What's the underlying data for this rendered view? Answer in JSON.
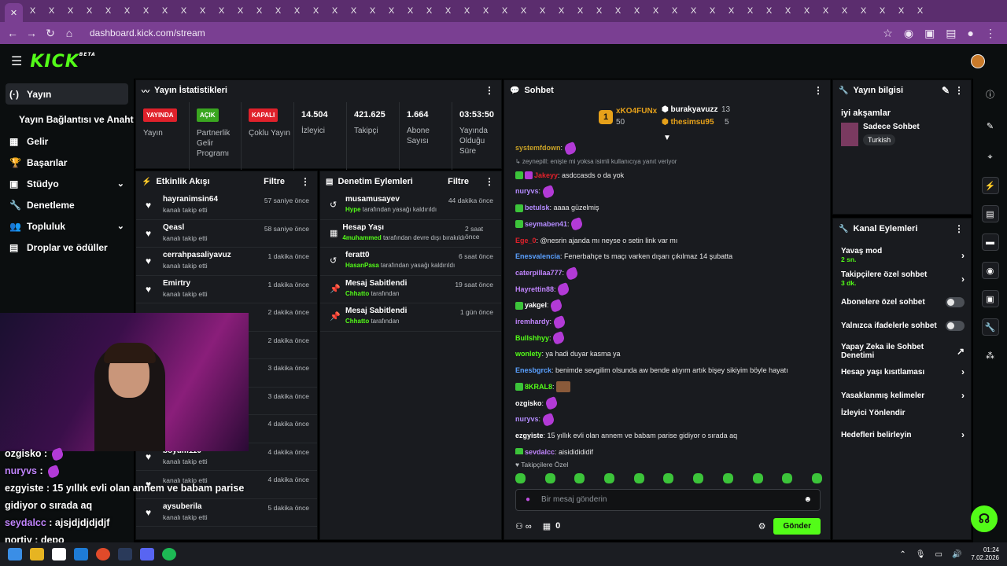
{
  "browser": {
    "url": "dashboard.kick.com/stream",
    "tab_icons": [
      "X",
      "X",
      "X",
      "X",
      "X",
      "X",
      "X",
      "X",
      "X",
      "X",
      "X",
      "X",
      "X",
      "X",
      "X",
      "X",
      "X",
      "X",
      "X",
      "X",
      "X",
      "X",
      "X",
      "X",
      "X",
      "X",
      "X",
      "X",
      "X",
      "X",
      "X",
      "X",
      "X",
      "X",
      "X",
      "X",
      "X",
      "X",
      "X",
      "X",
      "X",
      "X",
      "X",
      "X",
      "X",
      "X",
      "X",
      "X"
    ]
  },
  "header": {
    "logo": "KICK",
    "logo_sup": "BETA"
  },
  "sidebar": {
    "items": [
      {
        "label": "Yayın",
        "icon": "stream-icon",
        "glyph": "(·)",
        "selected": true
      },
      {
        "label": "Gelir",
        "icon": "revenue-icon",
        "glyph": "▦"
      },
      {
        "label": "Başarılar",
        "icon": "trophy-icon",
        "glyph": "🏆"
      },
      {
        "label": "Stüdyo",
        "icon": "studio-icon",
        "glyph": "▣",
        "chevron": true
      },
      {
        "label": "Denetleme",
        "icon": "wrench-icon",
        "glyph": "🔧"
      },
      {
        "label": "Topluluk",
        "icon": "community-icon",
        "glyph": "👥",
        "chevron": true
      },
      {
        "label": "Droplar ve ödüller",
        "icon": "gift-icon",
        "glyph": "▤"
      }
    ],
    "subitem": "Yayın Bağlantısı ve Anahtarı"
  },
  "stats": {
    "title": "Yayın İstatistikleri",
    "cards": [
      {
        "badge": "YAYINDA",
        "badge_color": "#e0212b",
        "label": "Yayın"
      },
      {
        "badge": "AÇIK",
        "badge_color": "#3aa620",
        "label": "Partnerlik Gelir Programı"
      },
      {
        "badge": "KAPALI",
        "badge_color": "#e0212b",
        "label": "Çoklu Yayın"
      },
      {
        "value": "14.504",
        "label": "İzleyici"
      },
      {
        "value": "421.625",
        "label": "Takipçi"
      },
      {
        "value": "1.664",
        "label": "Abone Sayısı"
      },
      {
        "value": "03:53:50",
        "label": "Yayında Olduğu Süre"
      }
    ]
  },
  "activity": {
    "title": "Etkinlik Akışı",
    "filter": "Filtre",
    "rows": [
      {
        "name": "hayranimsin64",
        "sub": "kanalı takip etti",
        "time": "57 saniye önce"
      },
      {
        "name": "Qeasl",
        "sub": "kanalı takip etti",
        "time": "58 saniye önce"
      },
      {
        "name": "cerrahpasaliyavuz",
        "sub": "kanalı takip etti",
        "time": "1 dakika önce"
      },
      {
        "name": "Emirtry",
        "sub": "kanalı takip etti",
        "time": "1 dakika önce"
      },
      {
        "name": "",
        "sub": "",
        "time": "2 dakika önce"
      },
      {
        "name": "",
        "sub": "",
        "time": "2 dakika önce"
      },
      {
        "name": "",
        "sub": "",
        "time": "3 dakika önce"
      },
      {
        "name": "",
        "sub": "",
        "time": "3 dakika önce"
      },
      {
        "name": "",
        "sub": "",
        "time": "4 dakika önce"
      },
      {
        "name": "boyum110",
        "sub": "kanalı takip etti",
        "time": "4 dakika önce"
      },
      {
        "name": "",
        "sub": "kanalı takip etti",
        "time": "4 dakika önce"
      },
      {
        "name": "aysuberila",
        "sub": "kanalı takip etti",
        "time": "5 dakika önce"
      }
    ]
  },
  "moderation": {
    "title": "Denetim Eylemleri",
    "filter": "Filtre",
    "rows": [
      {
        "icon": "undo-icon",
        "glyph": "↺",
        "name": "musamusayev",
        "actor": "Hype",
        "sub": " tarafından yasağı kaldırıldı",
        "time": "44 dakika önce"
      },
      {
        "icon": "calendar-icon",
        "glyph": "▦",
        "name": "Hesap Yaşı",
        "actor": "4muhammed",
        "sub": " tarafından devre dışı bırakıldı",
        "time": "2 saat önce"
      },
      {
        "icon": "undo-icon",
        "glyph": "↺",
        "name": "feratt0",
        "actor": "HasanPasa",
        "sub": " tarafından yasağı kaldırıldı",
        "time": "6 saat önce"
      },
      {
        "icon": "pin-icon",
        "glyph": "📌",
        "name": "Mesaj Sabitlendi",
        "actor": "Chhatto",
        "sub": " tarafından",
        "time": "19 saat önce"
      },
      {
        "icon": "pin-icon",
        "glyph": "📌",
        "name": "Mesaj Sabitlendi",
        "actor": "Chhatto",
        "sub": " tarafından",
        "time": "1 gün önce"
      }
    ]
  },
  "chat": {
    "title": "Sohbet",
    "leader": {
      "top_name": "xKO4FUNx",
      "top_count": "50",
      "second_name": "burakyavuzz",
      "second_count": "13",
      "third_name": "thesimsu95",
      "third_count": "5"
    },
    "reply_note": "zeynepill: enişte mi yoksa isimli kullanıcıya yanıt veriyor",
    "messages": [
      {
        "user": "systemfdown",
        "color": "#c9a227",
        "text": "",
        "emote": true
      },
      {
        "user": "Jakeyy",
        "color": "#e0212b",
        "text": ": asdccasds o da yok",
        "emote": false,
        "badges": 2
      },
      {
        "user": "nuryvs",
        "color": "#b48cff",
        "text": "",
        "emote": true
      },
      {
        "user": "betulsk",
        "color": "#b48cff",
        "text": ": aaaa güzelmiş",
        "emote": false,
        "badges": 1
      },
      {
        "user": "seymaben41",
        "color": "#b48cff",
        "text": "",
        "emote": true,
        "badges": 1
      },
      {
        "user": "Ege_0",
        "color": "#e0212b",
        "text": ": @nesrin ajanda mı neyse o setin link var mı",
        "emote": false
      },
      {
        "user": "Enesvalencia",
        "color": "#5aa0ff",
        "text": ": Fenerbahçe ts maçı varken dışarı çıkılmaz 14 şubatta",
        "emote": false
      },
      {
        "user": "caterpillaa777",
        "color": "#c084fc",
        "text": "",
        "emote": true
      },
      {
        "user": "Hayrettin88",
        "color": "#c084fc",
        "text": "",
        "emote": true
      },
      {
        "user": "yakgel",
        "color": "#ffffff",
        "text": "",
        "emote": true,
        "badges": 1
      },
      {
        "user": "iremhardy",
        "color": "#c084fc",
        "text": "",
        "emote": true
      },
      {
        "user": "Bullshhyy",
        "color": "#53fc18",
        "text": "",
        "emote": true
      },
      {
        "user": "wonlety",
        "color": "#53fc18",
        "text": ": ya hadi duyar kasma ya",
        "emote": false
      },
      {
        "user": "Enesbgrck",
        "color": "#5aa0ff",
        "text": ": benimde sevgilim olsunda aw bende alıyım artık bişey sikiyim böyle hayatı",
        "emote": false
      },
      {
        "user": "8KRAL8",
        "color": "#53fc18",
        "text": "",
        "emote": "pic",
        "badges": 1
      },
      {
        "user": "ozgisko",
        "color": "#ffffff",
        "text": "",
        "emote": true
      },
      {
        "user": "nuryvs",
        "color": "#b48cff",
        "text": "",
        "emote": true
      },
      {
        "user": "ezgyiste",
        "color": "#ffffff",
        "text": ": 15 yıllık evli olan annem ve babam parise gidiyor o sırada aq",
        "emote": false
      },
      {
        "user": "seydalcc",
        "color": "#c084fc",
        "text": ": ajsjdjdjdjdjf",
        "emote": false,
        "badges": 1
      }
    ],
    "sub_only": "Takipçilere Özel",
    "input_placeholder": "Bir mesaj gönderin",
    "points": "0",
    "send": "Gönder"
  },
  "stream_info": {
    "title": "Yayın bilgisi",
    "stream_title": "iyi akşamlar",
    "category": "Sadece Sohbet",
    "tag": "Turkish"
  },
  "channel_actions": {
    "title": "Kanal Eylemleri",
    "items": [
      {
        "label": "Yavaş mod",
        "sub": "2 sn.",
        "control": "arrow"
      },
      {
        "label": "Takipçilere özel sohbet",
        "sub": "3 dk.",
        "control": "arrow"
      },
      {
        "label": "Abonelere özel sohbet",
        "sub": "",
        "control": "toggle"
      },
      {
        "label": "Yalnızca ifadelerle sohbet",
        "sub": "",
        "control": "toggle"
      },
      {
        "label": "Yapay Zeka ile Sohbet Denetimi",
        "sub": "",
        "control": "external"
      },
      {
        "label": "Hesap yaşı kısıtlaması",
        "sub": "",
        "control": "arrow"
      },
      {
        "label": "Yasaklanmış kelimeler",
        "sub": "",
        "control": "arrow"
      },
      {
        "label": "İzleyici Yönlendir",
        "sub": "",
        "control": "none"
      },
      {
        "label": "Hedefleri belirleyin",
        "sub": "",
        "control": "arrow"
      }
    ]
  },
  "overlay_chat": [
    {
      "user": "ozgisko",
      "text": ":",
      "emote": true,
      "color": "#ffffff"
    },
    {
      "user": "nuryvs",
      "text": ":",
      "emote": true,
      "color": "#c084fc"
    },
    {
      "user": "ezgyiste",
      "text": ": 15 yıllık evli olan annem ve babam parise gidiyor o sırada aq",
      "emote": false,
      "color": "#ffffff"
    },
    {
      "user": "seydalcc",
      "text": ": ajsjdjdjdjdjf",
      "emote": false,
      "color": "#c084fc"
    },
    {
      "user": "nortiy",
      "text": ":      depo",
      "emote": false,
      "color": "#ffffff"
    }
  ],
  "taskbar": {
    "time": "01:24",
    "date": "7.02.2026"
  },
  "colors": {
    "accent": "#53fc18",
    "panel": "#191b1f",
    "bg": "#0b0e0f",
    "browser": "#7a3f92"
  }
}
